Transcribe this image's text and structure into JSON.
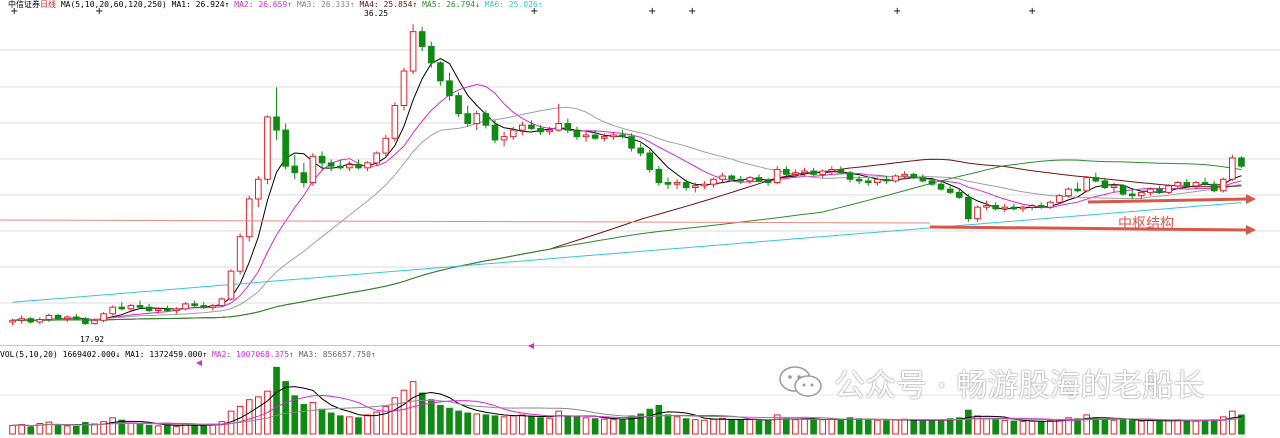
{
  "header": {
    "stock_name": "中信证券",
    "period": "日线",
    "ma_params": "MA(5,10,20,60,120,250)",
    "ma1": "MA1: 26.924↑",
    "ma2": "MA2: 26.659↑",
    "ma3": "MA3: 26.333↑",
    "ma4": "MA4: 25.854↑",
    "ma5": "MA5: 26.794↓",
    "ma6": "MA6: 25.026↑"
  },
  "volume_header": {
    "params": "VOL(5,10,20)",
    "vol": "1669402.000↓",
    "ma1": "MA1: 1372459.000↑",
    "ma2": "MA2: 1007068.375↑",
    "ma3": "MA3: 856657.750↑"
  },
  "price_labels": {
    "high": "36.25",
    "low": "17.92"
  },
  "annotation": "中枢结构",
  "watermark": {
    "text": "公众号 · 畅游股海的老船长",
    "icon": "wechat-icon"
  },
  "colors": {
    "up": "#e0202a",
    "down": "#0f8a12",
    "ma1": "#000000",
    "ma2": "#d42ad4",
    "ma3": "#a0a0a0",
    "ma4": "#6b1515",
    "ma5": "#2e8b2e",
    "ma6": "#35c8d8",
    "arrow": "#d9574a",
    "vol_ma1": "#000000",
    "vol_ma2": "#d42ad4",
    "vol_ma3": "#8a8a8a"
  },
  "chart_data": {
    "type": "line",
    "ylim": [
      17,
      37
    ],
    "grid": true,
    "candles": [
      [
        18.1,
        18.3,
        17.9,
        18.2
      ],
      [
        18.2,
        18.5,
        18.0,
        18.3
      ],
      [
        18.3,
        18.4,
        18.0,
        18.1
      ],
      [
        18.1,
        18.4,
        17.95,
        18.25
      ],
      [
        18.25,
        18.6,
        18.1,
        18.5
      ],
      [
        18.5,
        18.6,
        18.2,
        18.3
      ],
      [
        18.3,
        18.5,
        18.1,
        18.4
      ],
      [
        18.4,
        18.6,
        18.2,
        18.3
      ],
      [
        18.3,
        18.4,
        17.92,
        18.0
      ],
      [
        18.0,
        18.3,
        17.95,
        18.2
      ],
      [
        18.2,
        18.7,
        18.1,
        18.6
      ],
      [
        18.6,
        19.1,
        18.5,
        19.0
      ],
      [
        19.0,
        19.3,
        18.8,
        18.9
      ],
      [
        18.9,
        19.2,
        18.7,
        19.1
      ],
      [
        19.1,
        19.4,
        18.9,
        19.0
      ],
      [
        19.0,
        19.2,
        18.7,
        18.8
      ],
      [
        18.8,
        19.0,
        18.6,
        18.9
      ],
      [
        18.9,
        19.1,
        18.7,
        18.8
      ],
      [
        18.8,
        19.0,
        18.6,
        18.9
      ],
      [
        18.9,
        19.3,
        18.8,
        19.2
      ],
      [
        19.2,
        19.4,
        19.0,
        19.1
      ],
      [
        19.1,
        19.3,
        18.9,
        19.0
      ],
      [
        19.0,
        19.2,
        18.8,
        19.1
      ],
      [
        19.1,
        19.6,
        19.0,
        19.5
      ],
      [
        19.5,
        21.3,
        19.4,
        21.2
      ],
      [
        21.2,
        23.5,
        21.0,
        23.3
      ],
      [
        23.3,
        25.8,
        23.0,
        25.6
      ],
      [
        25.6,
        27.0,
        25.1,
        26.8
      ],
      [
        26.8,
        30.7,
        26.5,
        30.6
      ],
      [
        30.6,
        32.4,
        29.2,
        29.8
      ],
      [
        29.8,
        30.2,
        27.4,
        27.6
      ],
      [
        27.6,
        28.3,
        26.8,
        27.2
      ],
      [
        27.2,
        27.8,
        26.3,
        26.6
      ],
      [
        26.6,
        28.4,
        26.4,
        28.2
      ],
      [
        28.2,
        28.5,
        27.4,
        27.8
      ],
      [
        27.8,
        28.0,
        27.3,
        27.6
      ],
      [
        27.6,
        28.0,
        27.4,
        27.5
      ],
      [
        27.5,
        27.9,
        27.3,
        27.7
      ],
      [
        27.7,
        28.0,
        27.4,
        27.5
      ],
      [
        27.5,
        27.9,
        27.3,
        27.8
      ],
      [
        27.8,
        28.5,
        27.6,
        28.4
      ],
      [
        28.4,
        29.5,
        28.2,
        29.3
      ],
      [
        29.3,
        31.5,
        29.1,
        31.3
      ],
      [
        31.3,
        33.6,
        31.0,
        33.4
      ],
      [
        33.4,
        36.25,
        33.2,
        35.8
      ],
      [
        35.8,
        36.1,
        34.6,
        34.9
      ],
      [
        34.9,
        35.2,
        33.6,
        33.9
      ],
      [
        33.9,
        34.0,
        32.5,
        32.8
      ],
      [
        32.8,
        33.3,
        31.6,
        31.9
      ],
      [
        31.9,
        32.1,
        30.6,
        30.8
      ],
      [
        30.8,
        31.3,
        30.0,
        30.2
      ],
      [
        30.2,
        31.0,
        29.8,
        30.8
      ],
      [
        30.8,
        31.0,
        29.9,
        30.1
      ],
      [
        30.1,
        30.4,
        29.0,
        29.2
      ],
      [
        29.2,
        29.7,
        28.8,
        29.4
      ],
      [
        29.4,
        30.0,
        29.2,
        29.8
      ],
      [
        29.8,
        30.3,
        29.5,
        30.1
      ],
      [
        30.1,
        30.4,
        29.8,
        29.9
      ],
      [
        29.9,
        30.1,
        29.5,
        29.7
      ],
      [
        29.7,
        30.0,
        29.5,
        29.8
      ],
      [
        29.8,
        31.4,
        29.7,
        30.2
      ],
      [
        30.2,
        30.5,
        29.6,
        29.8
      ],
      [
        29.8,
        30.0,
        29.2,
        29.4
      ],
      [
        29.4,
        29.7,
        29.1,
        29.5
      ],
      [
        29.5,
        29.8,
        29.2,
        29.3
      ],
      [
        29.3,
        29.6,
        29.1,
        29.4
      ],
      [
        29.4,
        29.7,
        29.2,
        29.5
      ],
      [
        29.5,
        29.8,
        29.3,
        29.4
      ],
      [
        29.4,
        29.6,
        28.5,
        28.7
      ],
      [
        28.7,
        29.0,
        28.2,
        28.4
      ],
      [
        28.4,
        28.6,
        27.2,
        27.4
      ],
      [
        27.4,
        27.6,
        26.4,
        26.6
      ],
      [
        26.6,
        26.9,
        26.2,
        26.5
      ],
      [
        26.5,
        26.8,
        26.2,
        26.6
      ],
      [
        26.6,
        26.8,
        26.1,
        26.3
      ],
      [
        26.3,
        26.6,
        26.0,
        26.4
      ],
      [
        26.4,
        26.7,
        26.2,
        26.5
      ],
      [
        26.5,
        26.9,
        26.3,
        26.8
      ],
      [
        26.8,
        27.2,
        26.6,
        27.0
      ],
      [
        27.0,
        27.1,
        26.7,
        26.8
      ],
      [
        26.8,
        27.0,
        26.5,
        26.7
      ],
      [
        26.7,
        27.0,
        26.5,
        26.9
      ],
      [
        26.9,
        27.1,
        26.6,
        26.7
      ],
      [
        26.7,
        26.9,
        26.4,
        26.6
      ],
      [
        26.6,
        27.6,
        26.5,
        27.4
      ],
      [
        27.4,
        27.6,
        27.0,
        27.1
      ],
      [
        27.1,
        27.4,
        26.9,
        27.2
      ],
      [
        27.2,
        27.5,
        27.0,
        27.3
      ],
      [
        27.3,
        27.5,
        27.0,
        27.1
      ],
      [
        27.1,
        27.4,
        26.9,
        27.3
      ],
      [
        27.3,
        27.6,
        27.1,
        27.4
      ],
      [
        27.4,
        27.6,
        27.1,
        27.2
      ],
      [
        27.2,
        27.3,
        26.6,
        26.8
      ],
      [
        26.8,
        27.0,
        26.5,
        26.7
      ],
      [
        26.7,
        26.9,
        26.4,
        26.6
      ],
      [
        26.6,
        26.9,
        26.4,
        26.8
      ],
      [
        26.8,
        27.0,
        26.5,
        26.7
      ],
      [
        26.7,
        27.1,
        26.6,
        27.0
      ],
      [
        27.0,
        27.3,
        26.8,
        27.1
      ],
      [
        27.1,
        27.2,
        26.8,
        26.9
      ],
      [
        26.9,
        27.1,
        26.6,
        26.7
      ],
      [
        26.7,
        26.9,
        26.4,
        26.5
      ],
      [
        26.5,
        26.7,
        26.1,
        26.2
      ],
      [
        26.2,
        26.4,
        25.9,
        26.0
      ],
      [
        26.0,
        26.2,
        25.6,
        25.7
      ],
      [
        25.7,
        25.9,
        24.2,
        24.4
      ],
      [
        24.4,
        25.2,
        24.2,
        25.1
      ],
      [
        25.1,
        25.5,
        24.9,
        25.2
      ],
      [
        25.2,
        25.4,
        24.9,
        25.0
      ],
      [
        25.0,
        25.3,
        24.8,
        25.1
      ],
      [
        25.1,
        25.3,
        24.9,
        25.0
      ],
      [
        25.0,
        25.2,
        24.8,
        25.1
      ],
      [
        25.1,
        25.3,
        24.9,
        25.2
      ],
      [
        25.2,
        25.4,
        25.0,
        25.1
      ],
      [
        25.1,
        25.5,
        25.0,
        25.4
      ],
      [
        25.4,
        25.9,
        25.3,
        25.8
      ],
      [
        25.8,
        26.3,
        25.7,
        26.2
      ],
      [
        26.2,
        26.6,
        26.0,
        26.1
      ],
      [
        26.1,
        27.0,
        26.0,
        26.9
      ],
      [
        26.9,
        27.2,
        26.6,
        26.7
      ],
      [
        26.7,
        26.9,
        26.2,
        26.3
      ],
      [
        26.3,
        26.6,
        26.0,
        26.4
      ],
      [
        26.4,
        26.5,
        25.8,
        25.9
      ],
      [
        25.9,
        26.2,
        25.6,
        25.8
      ],
      [
        25.8,
        26.1,
        25.6,
        26.0
      ],
      [
        26.0,
        26.3,
        25.8,
        26.2
      ],
      [
        26.2,
        26.4,
        25.9,
        26.0
      ],
      [
        26.0,
        26.5,
        25.9,
        26.4
      ],
      [
        26.4,
        26.7,
        26.2,
        26.6
      ],
      [
        26.6,
        26.8,
        26.3,
        26.4
      ],
      [
        26.4,
        26.7,
        26.2,
        26.6
      ],
      [
        26.6,
        26.9,
        26.4,
        26.5
      ],
      [
        26.5,
        26.7,
        26.0,
        26.1
      ],
      [
        26.1,
        26.9,
        26.0,
        26.8
      ],
      [
        26.8,
        28.3,
        26.7,
        28.1
      ],
      [
        28.1,
        28.2,
        27.5,
        27.6
      ]
    ],
    "volume": [
      18,
      20,
      15,
      22,
      25,
      19,
      17,
      16,
      24,
      21,
      26,
      34,
      29,
      22,
      20,
      18,
      17,
      19,
      16,
      21,
      18,
      17,
      19,
      26,
      48,
      58,
      72,
      78,
      90,
      140,
      110,
      80,
      62,
      66,
      52,
      44,
      38,
      36,
      34,
      40,
      46,
      58,
      76,
      92,
      110,
      86,
      72,
      60,
      54,
      48,
      44,
      42,
      40,
      38,
      36,
      38,
      40,
      36,
      34,
      33,
      48,
      38,
      36,
      34,
      32,
      31,
      30,
      29,
      38,
      42,
      52,
      60,
      40,
      36,
      32,
      30,
      29,
      31,
      33,
      30,
      29,
      31,
      28,
      27,
      40,
      32,
      30,
      31,
      29,
      30,
      32,
      28,
      34,
      32,
      30,
      29,
      28,
      30,
      31,
      28,
      27,
      28,
      30,
      32,
      34,
      50,
      38,
      32,
      30,
      28,
      27,
      26,
      27,
      26,
      28,
      30,
      34,
      32,
      40,
      34,
      30,
      29,
      30,
      28,
      27,
      28,
      26,
      29,
      30,
      28,
      27,
      28,
      30,
      36,
      48,
      40
    ],
    "ma_periods": [
      5,
      10,
      20,
      60,
      120,
      250
    ],
    "vol_ma_periods": [
      5,
      10,
      20
    ]
  }
}
